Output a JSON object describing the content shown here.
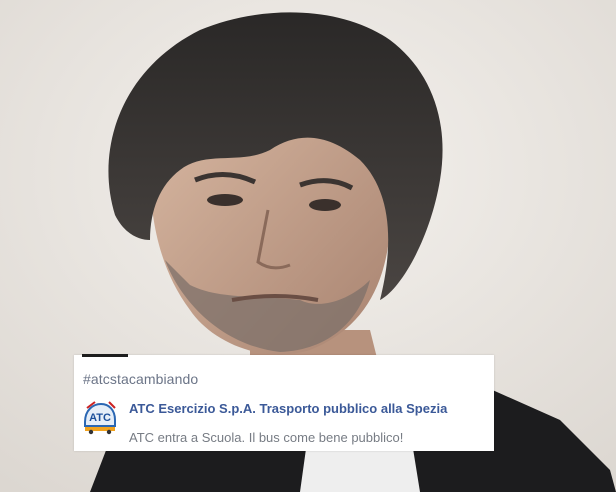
{
  "post": {
    "hashtag": "#atcstacambiando",
    "page_name": "ATC Esercizio S.p.A. Trasporto pubblico alla Spezia",
    "text": "ATC entra a Scuola. Il bus come bene pubblico!",
    "logo_text": "ATC",
    "logo_icon": "atc-logo"
  },
  "colors": {
    "link": "#3b5998",
    "muted": "#777c84",
    "hashtag": "#6b7487"
  }
}
